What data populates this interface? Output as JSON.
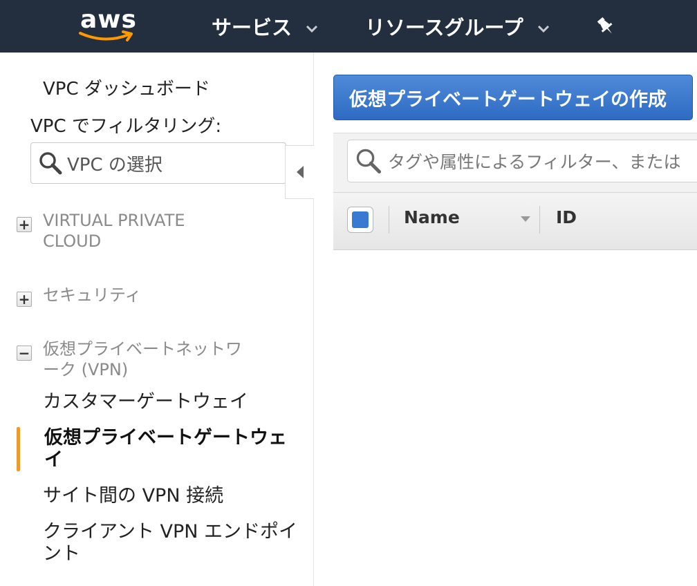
{
  "topbar": {
    "logo_text": "aws",
    "services_label": "サービス",
    "resource_groups_label": "リソースグループ",
    "pin_icon": "pin-icon"
  },
  "sidebar": {
    "dashboard_label": "VPC ダッシュボード",
    "filter_label": "VPC でフィルタリング:",
    "vpc_select_placeholder": "VPC の選択",
    "sections": [
      {
        "label": "VIRTUAL PRIVATE CLOUD",
        "state": "collapsed",
        "toggle": "+"
      },
      {
        "label": "セキュリティ",
        "state": "collapsed",
        "toggle": "+"
      },
      {
        "label": "仮想プライベートネットワーク (VPN)",
        "state": "expanded",
        "toggle": "−"
      }
    ],
    "vpn_items": [
      {
        "label": "カスタマーゲートウェイ",
        "active": false
      },
      {
        "label": "仮想プライベートゲートウェイ",
        "active": true
      },
      {
        "label": "サイト間の VPN 接続",
        "active": false
      },
      {
        "label": "クライアント VPN エンドポイント",
        "active": false
      }
    ]
  },
  "main": {
    "create_button_label": "仮想プライベートゲートウェイの作成",
    "filter_placeholder": "タグや属性によるフィルター、または",
    "table": {
      "columns": [
        "Name",
        "ID"
      ]
    }
  },
  "colors": {
    "topbar_bg": "#232f3e",
    "primary_button": "#2f6bc3",
    "active_accent": "#ec9b2c",
    "aws_smile": "#ff9900"
  }
}
